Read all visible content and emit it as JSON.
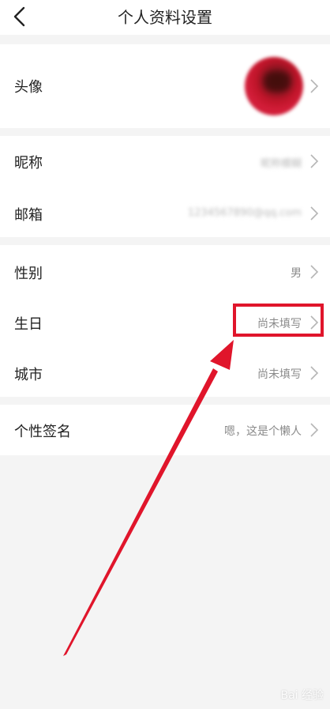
{
  "header": {
    "title": "个人资料设置"
  },
  "avatar_row": {
    "label": "头像"
  },
  "account_section": [
    {
      "label": "昵称",
      "value": "昵称模糊"
    },
    {
      "label": "邮箱",
      "value": "1234567890@qq.com"
    }
  ],
  "info_section": [
    {
      "label": "性别",
      "value": "男"
    },
    {
      "label": "生日",
      "value": "尚未填写"
    },
    {
      "label": "城市",
      "value": "尚未填写"
    }
  ],
  "signature_row": {
    "label": "个性签名",
    "value": "嗯，这是个懒人"
  },
  "annotation": {
    "color": "#e0152b"
  },
  "watermark": {
    "text": "Bai 经验"
  }
}
